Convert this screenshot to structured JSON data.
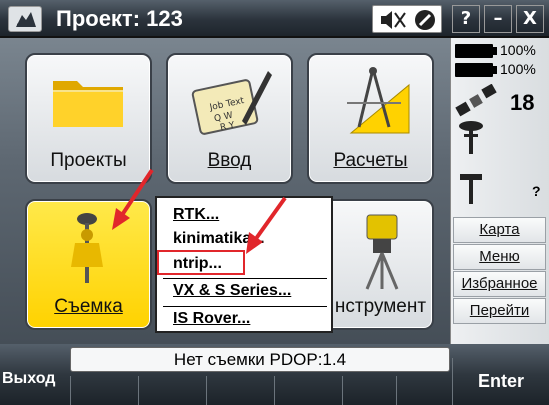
{
  "titlebar": {
    "title": "Проект: 123",
    "help_label": "?",
    "minimize_label": "–",
    "close_label": "X"
  },
  "tiles": [
    {
      "label": "Проекты",
      "icon": "folder-icon"
    },
    {
      "label": "Ввод",
      "icon": "keypad-pen-icon"
    },
    {
      "label": "Расчеты",
      "icon": "compass-ruler-icon"
    },
    {
      "label": "Съемка",
      "icon": "gnss-survey-icon",
      "selected": true
    },
    {
      "label": "нструмент",
      "icon": "total-station-icon"
    }
  ],
  "menu": {
    "items": [
      "RTK...",
      "kinimatika...",
      "ntrip...",
      "VX & S Series...",
      "IS Rover..."
    ],
    "highlighted": "ntrip..."
  },
  "status_panel": {
    "battery1": "100%",
    "battery2": "100%",
    "satellites": "18",
    "unknown": "?"
  },
  "side_buttons": [
    "Карта",
    "Меню",
    "Избранное",
    "Перейти"
  ],
  "bottom": {
    "status": "Нет съемки  PDOP:1.4",
    "exit_label": "Выход",
    "enter_label": "Enter"
  },
  "colors": {
    "accent_yellow": "#ffd200",
    "highlight_red": "#e1262b",
    "chrome_dark": "#2b333c"
  }
}
